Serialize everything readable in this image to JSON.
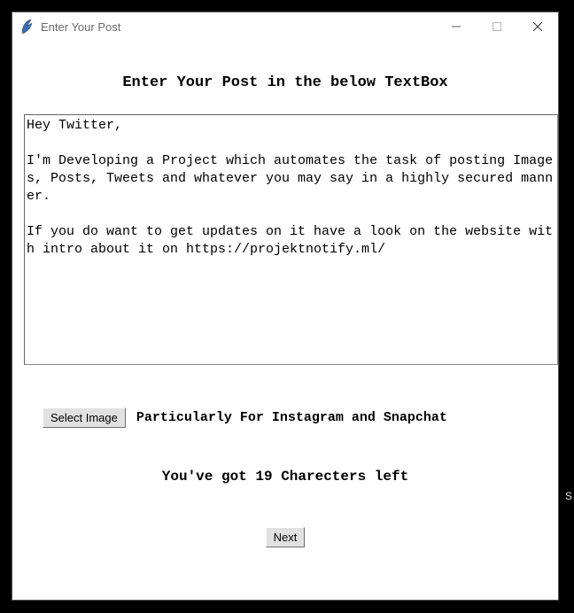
{
  "window": {
    "title": "Enter Your Post"
  },
  "heading": "Enter Your Post in the below TextBox",
  "textbox": {
    "value": "Hey Twitter,\n\nI'm Developing a Project which automates the task of posting Images, Posts, Tweets and whatever you may say in a highly secured manner.\n\nIf you do want to get updates on it have a look on the website with intro about it on https://projektnotify.ml/"
  },
  "select_image": {
    "button_label": "Select Image",
    "hint": "Particularly For Instagram and Snapchat"
  },
  "chars_left_label": "You've got 19 Charecters left",
  "next_button_label": "Next",
  "stray_char": "S"
}
